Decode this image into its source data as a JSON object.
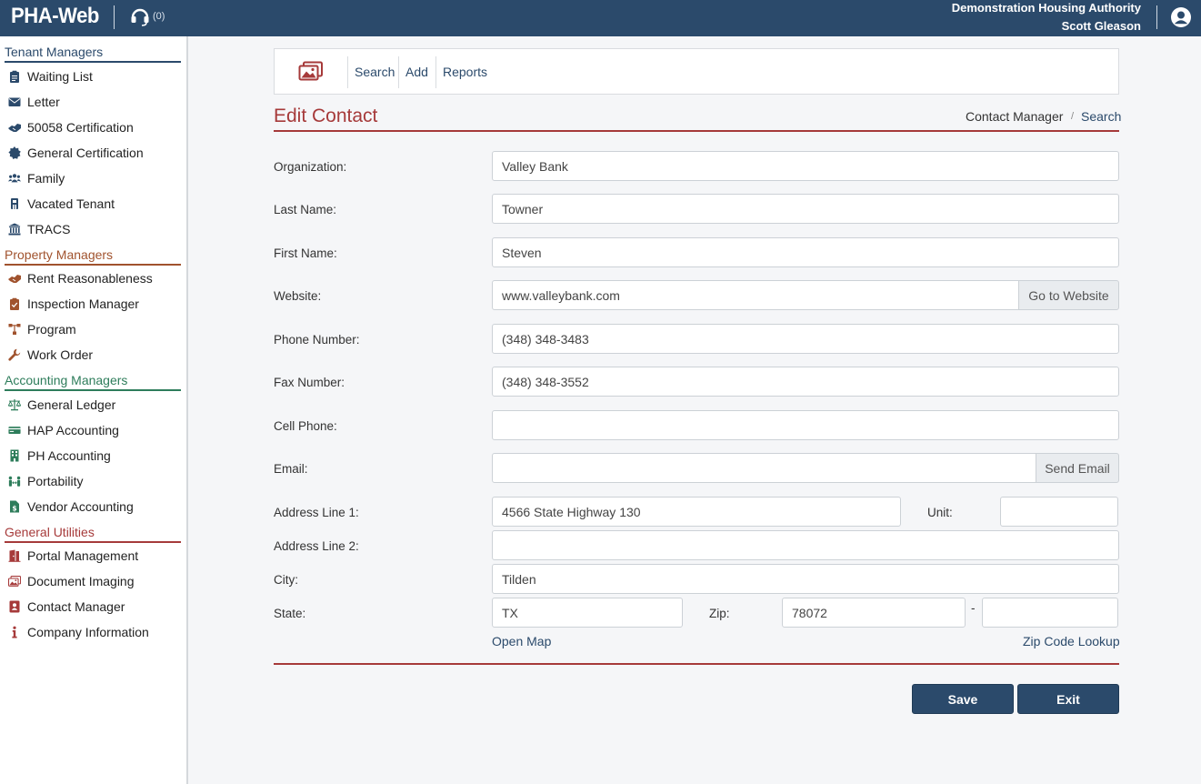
{
  "header": {
    "brand": "PHA-Web",
    "support_count": "(0)",
    "org_name": "Demonstration Housing Authority",
    "user_name": "Scott Gleason",
    "bg_color": "#2b4a6b"
  },
  "sidebar": {
    "sections": [
      {
        "title": "Tenant Managers",
        "color": "#2b4a6b",
        "items": [
          {
            "label": "Waiting List",
            "icon": "clipboard-icon"
          },
          {
            "label": "Letter",
            "icon": "envelope-icon"
          },
          {
            "label": "50058 Certification",
            "icon": "handshake-icon"
          },
          {
            "label": "General Certification",
            "icon": "certificate-icon"
          },
          {
            "label": "Family",
            "icon": "users-icon"
          },
          {
            "label": "Vacated Tenant",
            "icon": "walking-icon"
          },
          {
            "label": "TRACS",
            "icon": "bank-icon"
          }
        ]
      },
      {
        "title": "Property Managers",
        "color": "#a0522d",
        "items": [
          {
            "label": "Rent Reasonableness",
            "icon": "handshake-icon"
          },
          {
            "label": "Inspection Manager",
            "icon": "clipboard-check-icon"
          },
          {
            "label": "Program",
            "icon": "sitemap-icon"
          },
          {
            "label": "Work Order",
            "icon": "wrench-icon"
          }
        ]
      },
      {
        "title": "Accounting Managers",
        "color": "#2e7d5b",
        "items": [
          {
            "label": "General Ledger",
            "icon": "balance-scale-icon"
          },
          {
            "label": "HAP Accounting",
            "icon": "money-bill-icon"
          },
          {
            "label": "PH Accounting",
            "icon": "building-icon"
          },
          {
            "label": "Portability",
            "icon": "people-arrows-icon"
          },
          {
            "label": "Vendor Accounting",
            "icon": "file-invoice-dollar-icon"
          }
        ]
      },
      {
        "title": "General Utilities",
        "color": "#a63a3a",
        "items": [
          {
            "label": "Portal Management",
            "icon": "door-open-icon"
          },
          {
            "label": "Document Imaging",
            "icon": "images-icon"
          },
          {
            "label": "Contact Manager",
            "icon": "address-book-icon"
          },
          {
            "label": "Company Information",
            "icon": "info-icon"
          }
        ]
      }
    ]
  },
  "toolbar": {
    "icon": "images-icon",
    "search": "Search",
    "add": "Add",
    "reports": "Reports"
  },
  "page": {
    "title": "Edit Contact",
    "breadcrumb_current": "Contact Manager",
    "breadcrumb_sep": "/",
    "breadcrumb_link": "Search",
    "accent_color": "#a63a3a"
  },
  "form": {
    "organization": {
      "label": "Organization:",
      "value": "Valley Bank"
    },
    "last_name": {
      "label": "Last Name:",
      "value": "Towner"
    },
    "first_name": {
      "label": "First Name:",
      "value": "Steven"
    },
    "website": {
      "label": "Website:",
      "value": "www.valleybank.com",
      "button": "Go to Website"
    },
    "phone": {
      "label": "Phone Number:",
      "value": "(348) 348-3483"
    },
    "fax": {
      "label": "Fax Number:",
      "value": "(348) 348-3552"
    },
    "cell": {
      "label": "Cell Phone:",
      "value": ""
    },
    "email": {
      "label": "Email:",
      "value": "",
      "button": "Send Email"
    },
    "address1": {
      "label": "Address Line 1:",
      "value": "4566 State Highway 130"
    },
    "unit": {
      "label": "Unit:",
      "value": ""
    },
    "address2": {
      "label": "Address Line 2:",
      "value": ""
    },
    "city": {
      "label": "City:",
      "value": "Tilden"
    },
    "state": {
      "label": "State:",
      "value": "TX"
    },
    "zip": {
      "label": "Zip:",
      "value": "78072",
      "dash": "-",
      "ext": ""
    },
    "open_map": "Open Map",
    "zip_lookup": "Zip Code Lookup"
  },
  "actions": {
    "save": "Save",
    "exit": "Exit"
  }
}
